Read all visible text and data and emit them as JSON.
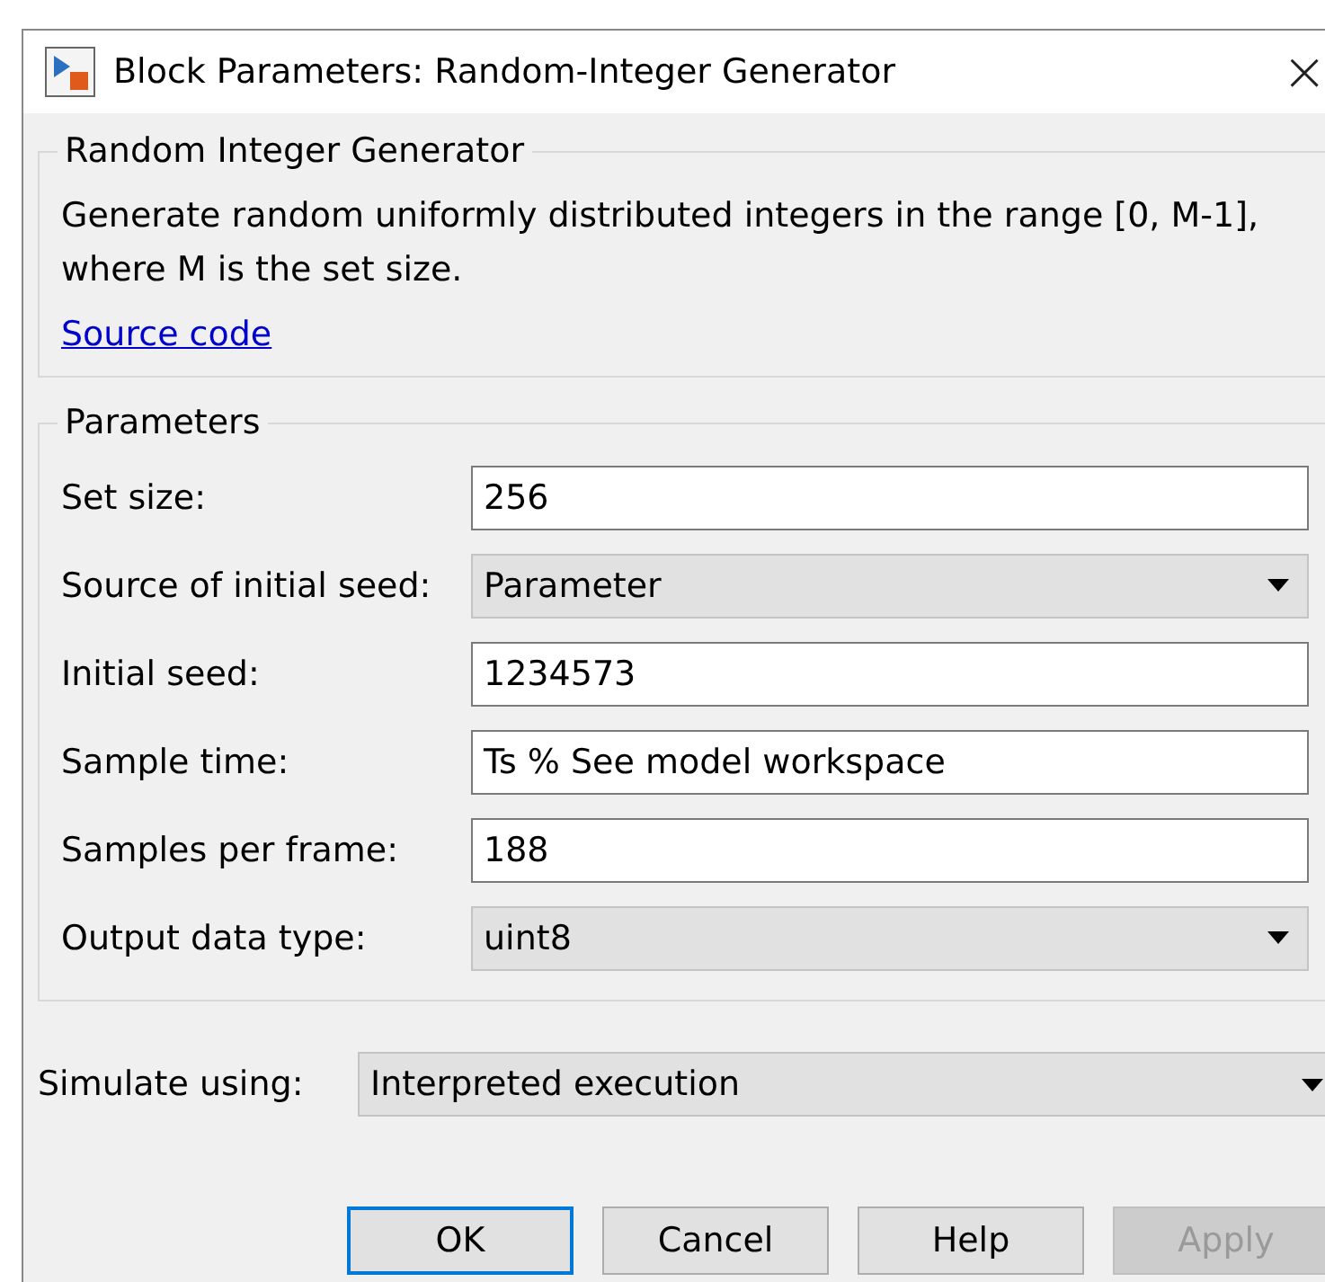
{
  "window": {
    "title": "Block Parameters: Random-Integer Generator",
    "close": "×"
  },
  "description_group": {
    "title": "Random Integer Generator",
    "text": "Generate random uniformly distributed integers in the range [0, M-1], where M is the set size.",
    "link": "Source code"
  },
  "parameters": {
    "title": "Parameters",
    "rows": [
      {
        "label": "Set size:",
        "kind": "text",
        "value": "256"
      },
      {
        "label": "Source of initial seed:",
        "kind": "dropdown",
        "value": "Parameter"
      },
      {
        "label": "Initial seed:",
        "kind": "text",
        "value": "1234573"
      },
      {
        "label": "Sample time:",
        "kind": "text",
        "value": "Ts % See model workspace"
      },
      {
        "label": "Samples per frame:",
        "kind": "text",
        "value": "188"
      },
      {
        "label": "Output data type:",
        "kind": "dropdown",
        "value": "uint8"
      }
    ]
  },
  "simulate": {
    "label": "Simulate using:",
    "value": "Interpreted execution"
  },
  "buttons": [
    {
      "label": "OK",
      "default": true,
      "disabled": false
    },
    {
      "label": "Cancel",
      "default": false,
      "disabled": false
    },
    {
      "label": "Help",
      "default": false,
      "disabled": false
    },
    {
      "label": "Apply",
      "default": false,
      "disabled": true
    }
  ]
}
